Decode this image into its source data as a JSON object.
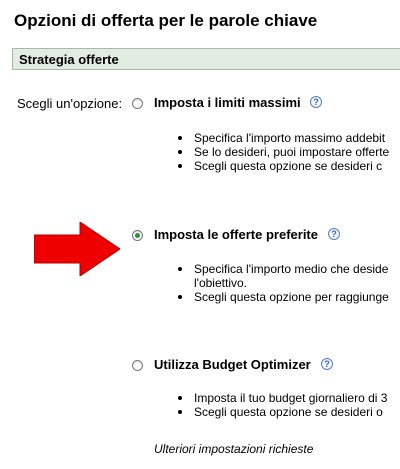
{
  "page": {
    "title": "Opzioni di offerta per le parole chiave"
  },
  "section": {
    "title": "Strategia offerte"
  },
  "choose_label": "Scegli un'opzione:",
  "options": [
    {
      "label": "Imposta i limiti massimi",
      "selected": false,
      "bullets": [
        "Specifica l'importo massimo addebit",
        "Se lo desideri, puoi impostare offerte",
        "Scegli questa opzione se desideri c"
      ]
    },
    {
      "label": "Imposta le offerte preferite",
      "selected": true,
      "bullets": [
        "Specifica l'importo medio che deside",
        "l'obiettivo.",
        "Scegli questa opzione per raggiunge"
      ]
    },
    {
      "label": "Utilizza Budget Optimizer",
      "selected": false,
      "bullets": [
        "Imposta il tuo budget giornaliero di 3",
        "Scegli questa opzione se desideri o"
      ]
    }
  ],
  "help_icon_glyph": "?",
  "footer_note": "Ulteriori impostazioni richieste",
  "colors": {
    "section_bg": "#e3ece3",
    "arrow": "#ee0000",
    "help": "#3c64b4",
    "radio_selected": "#2f8f2f"
  },
  "icons": {
    "arrow": "red-arrow-right-icon",
    "help": "help-question-icon"
  }
}
